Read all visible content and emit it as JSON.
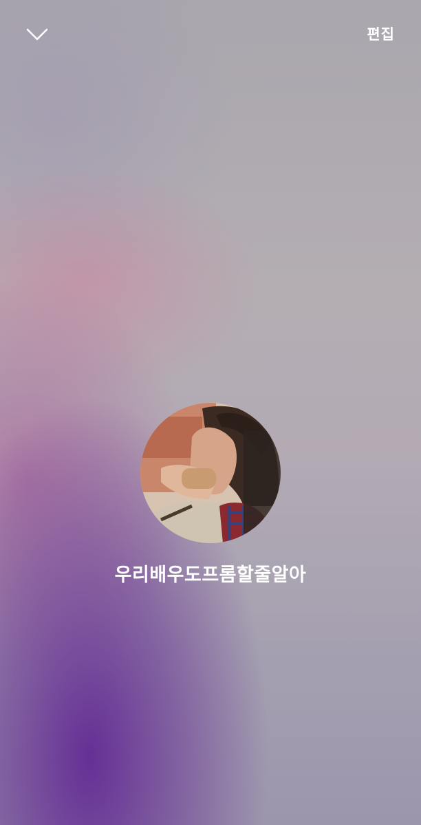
{
  "header": {
    "collapse_icon": "chevron-down-icon",
    "edit_label": "편집"
  },
  "profile": {
    "name": "우리배우도프롬할줄알아",
    "avatar": "profile-photo"
  },
  "colors": {
    "background_top": "#a9a6ad",
    "background_accent_pink": "#cd82a0",
    "background_accent_purple": "#622a94",
    "text": "#ffffff"
  }
}
